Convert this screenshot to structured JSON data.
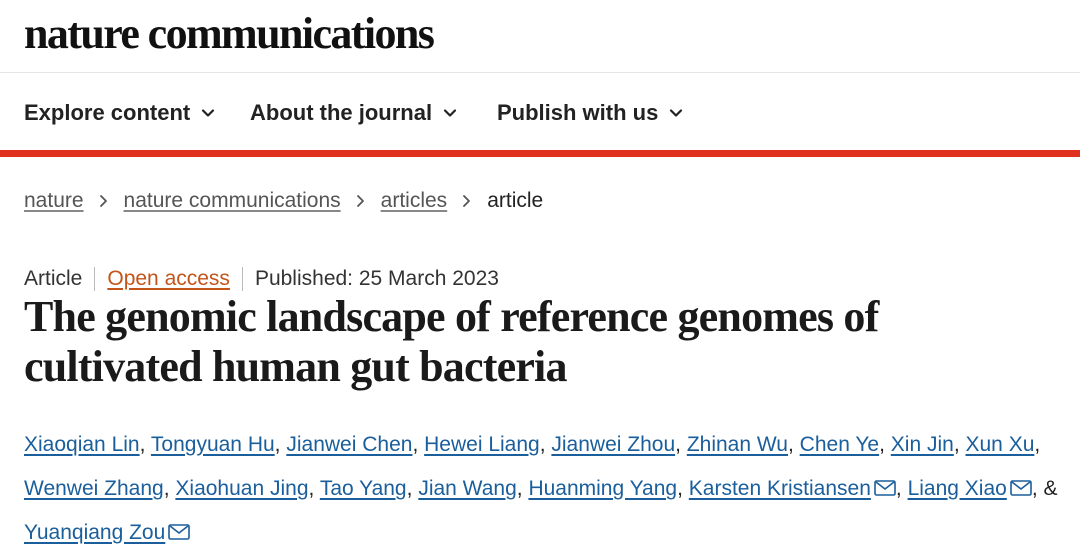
{
  "header": {
    "logo": "nature communications"
  },
  "nav": {
    "items": [
      {
        "label": "Explore content",
        "icon": "chevron-down-icon"
      },
      {
        "label": "About the journal",
        "icon": "chevron-down-icon"
      },
      {
        "label": "Publish with us",
        "icon": "chevron-down-icon"
      }
    ],
    "accent_color": "#e0301e"
  },
  "breadcrumb": {
    "items": [
      "nature",
      "nature communications",
      "articles"
    ],
    "current": "article",
    "separator_icon": "chevron-right-icon"
  },
  "article": {
    "type": "Article",
    "access": "Open access",
    "published": "Published: 25 March 2023",
    "title": "The genomic landscape of reference genomes of cultivated human gut bacteria",
    "authors": [
      {
        "name": "Xiaoqian Lin"
      },
      {
        "name": "Tongyuan Hu"
      },
      {
        "name": "Jianwei Chen"
      },
      {
        "name": "Hewei Liang"
      },
      {
        "name": "Jianwei Zhou"
      },
      {
        "name": "Zhinan Wu"
      },
      {
        "name": "Chen Ye"
      },
      {
        "name": "Xin Jin"
      },
      {
        "name": "Xun Xu"
      },
      {
        "name": "Wenwei Zhang"
      },
      {
        "name": "Xiaohuan Jing"
      },
      {
        "name": "Tao Yang"
      },
      {
        "name": "Jian Wang"
      },
      {
        "name": "Huanming Yang"
      },
      {
        "name": "Karsten Kristiansen",
        "email_icon": "mail-icon"
      },
      {
        "name": "Liang Xiao",
        "email_icon": "mail-icon"
      },
      {
        "name": "Yuanqiang Zou",
        "email_icon": "mail-icon"
      }
    ],
    "separator": ", ",
    "final_joiner": "&",
    "colors": {
      "author_link": "#1a5e9b",
      "open_access": "#c3541a"
    }
  }
}
